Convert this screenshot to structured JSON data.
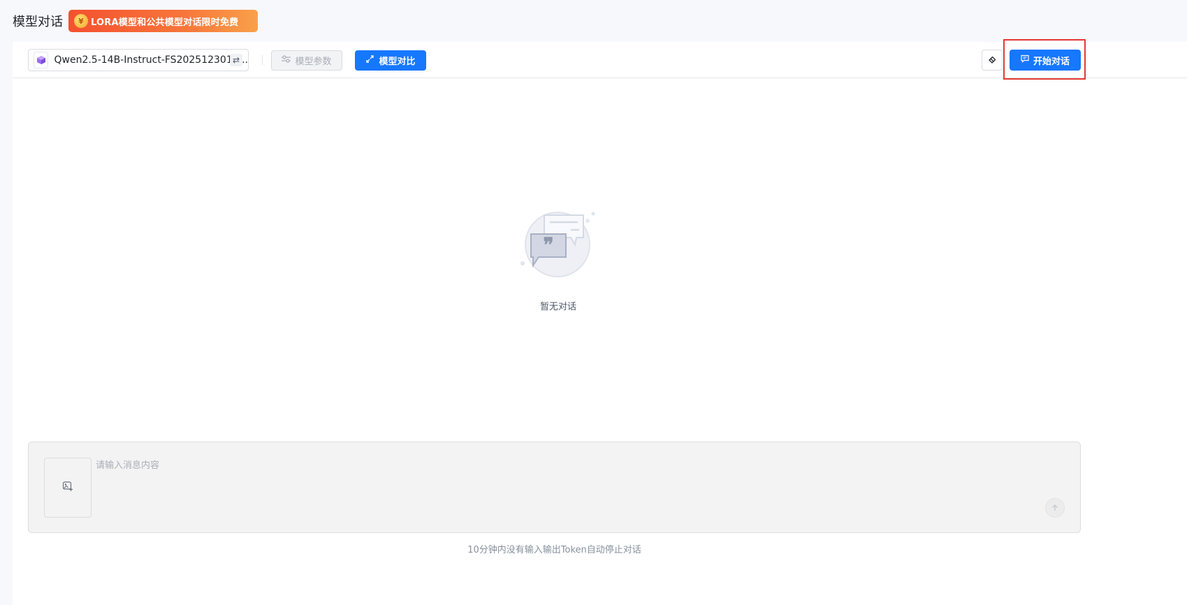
{
  "header": {
    "title": "模型对话",
    "promo_text": "LORA模型和公共模型对话限时免费",
    "promo_colors": [
      "#f4512f",
      "#f9a04a"
    ]
  },
  "toolbar": {
    "model_name": "Qwen2.5-14B-Instruct-FS2025123011...",
    "params_label": "模型参数",
    "compare_label": "模型对比",
    "start_label": "开始对话",
    "icons": {
      "model": "cube-icon",
      "swap": "swap-icon",
      "params": "sliders-icon",
      "compare": "compare-icon",
      "clear": "eraser-icon",
      "start": "chat-icon"
    }
  },
  "empty_state": {
    "text": "暂无对话",
    "icon": "empty-chat-illustration"
  },
  "composer": {
    "placeholder": "请输入消息内容",
    "upload_icon": "image-add-icon",
    "send_icon": "arrow-up-icon"
  },
  "footer_note": "10分钟内没有输入输出Token自动停止对话",
  "colors": {
    "primary": "#1677ff",
    "highlight": "#e53935",
    "background": "#f7f8fc"
  }
}
